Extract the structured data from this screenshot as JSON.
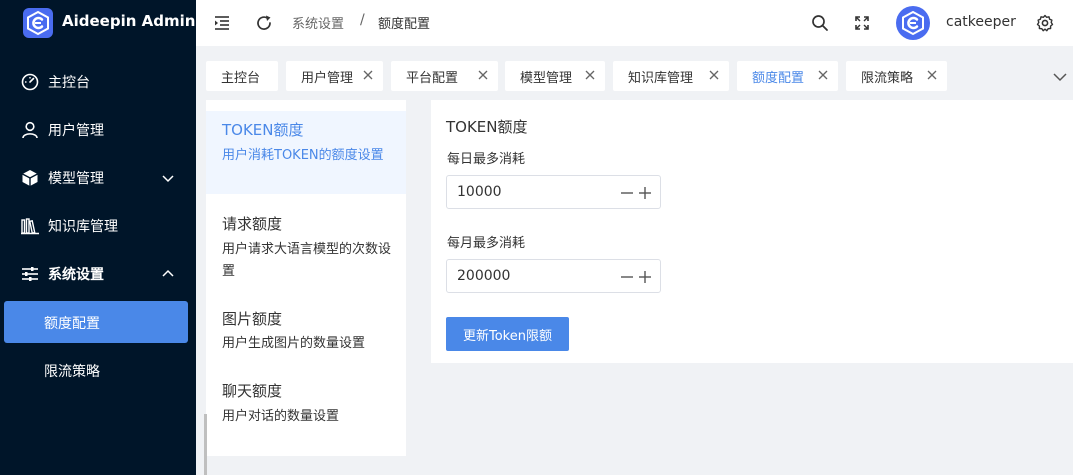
{
  "app": {
    "title": "Aideepin Admin"
  },
  "sidebar": {
    "items": [
      {
        "label": "主控台",
        "icon": "dashboard-icon"
      },
      {
        "label": "用户管理",
        "icon": "user-icon"
      },
      {
        "label": "模型管理",
        "icon": "box-icon",
        "expanded": false
      },
      {
        "label": "知识库管理",
        "icon": "library-icon"
      },
      {
        "label": "系统设置",
        "icon": "sliders-icon",
        "expanded": true
      }
    ],
    "subitems": [
      {
        "label": "额度配置",
        "active": true
      },
      {
        "label": "限流策略",
        "active": false
      }
    ]
  },
  "header": {
    "breadcrumb": [
      "系统设置",
      "额度配置"
    ],
    "separator": "/",
    "username": "catkeeper"
  },
  "tabs": [
    {
      "label": "主控台",
      "closable": false
    },
    {
      "label": "用户管理",
      "closable": true
    },
    {
      "label": "平台配置",
      "closable": true
    },
    {
      "label": "模型管理",
      "closable": true
    },
    {
      "label": "知识库管理",
      "closable": true
    },
    {
      "label": "额度配置",
      "closable": true,
      "active": true
    },
    {
      "label": "限流策略",
      "closable": true
    }
  ],
  "settings_list": [
    {
      "title": "TOKEN额度",
      "desc": "用户消耗TOKEN的额度设置",
      "active": true
    },
    {
      "title": "请求额度",
      "desc": "用户请求大语言模型的次数设置"
    },
    {
      "title": "图片额度",
      "desc": "用户生成图片的数量设置"
    },
    {
      "title": "聊天额度",
      "desc": "用户对话的数量设置"
    }
  ],
  "form": {
    "title": "TOKEN额度",
    "daily_label": "每日最多消耗",
    "daily_value": "10000",
    "monthly_label": "每月最多消耗",
    "monthly_value": "200000",
    "submit_label": "更新Token限额"
  },
  "colors": {
    "sidebar_bg": "#001529",
    "primary": "#4a88e8",
    "avatar": "#4a6cf0"
  }
}
